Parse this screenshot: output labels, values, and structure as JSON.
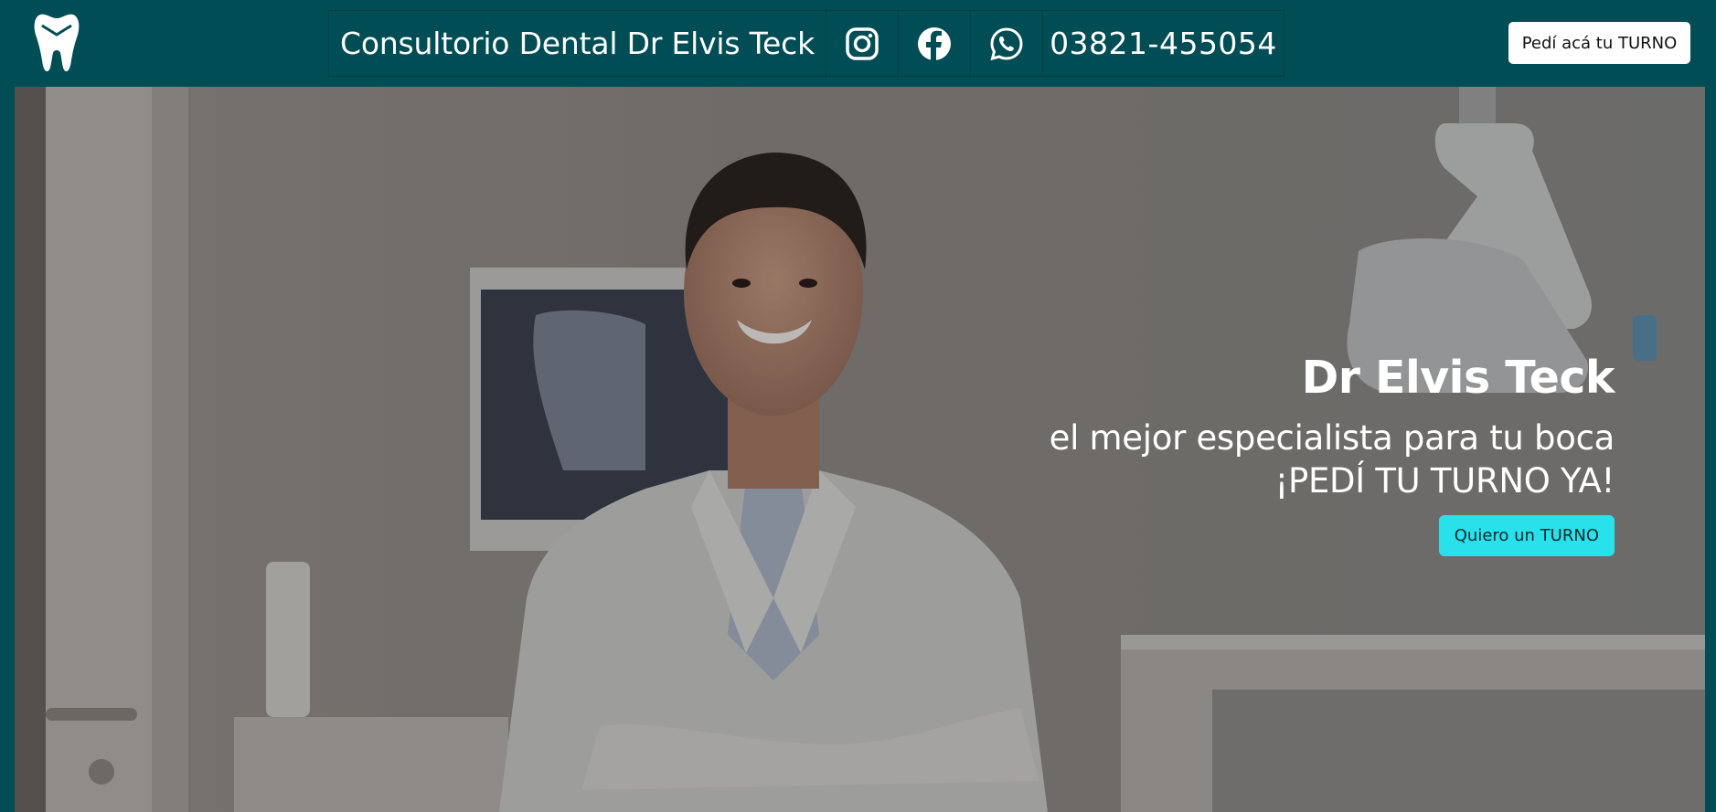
{
  "navbar": {
    "logo_icon": "tooth-icon",
    "title": "Consultorio Dental Dr Elvis Teck",
    "social_icons": [
      "instagram-icon",
      "facebook-icon",
      "whatsapp-icon"
    ],
    "phone": "03821-455054",
    "cta_label": "Pedí acá tu TURNO"
  },
  "hero": {
    "title": "Dr Elvis Teck",
    "subtitle_line1": "el mejor especialista para tu boca",
    "subtitle_line2": "¡PEDÍ TU TURNO YA!",
    "cta_label": "Quiero un TURNO",
    "background_image": "dentist-smiling-in-clinic-photo"
  },
  "colors": {
    "nav_background": "#014d55",
    "hero_cta": "#29e1ea",
    "nav_cta": "#ffffff",
    "text": "#ffffff"
  }
}
